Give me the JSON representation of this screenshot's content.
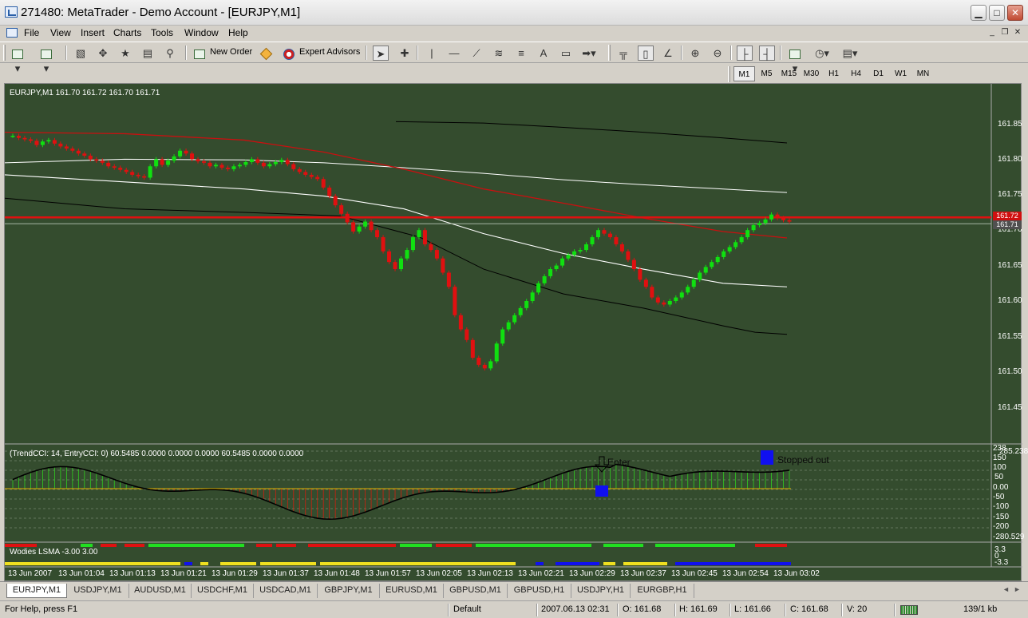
{
  "window": {
    "title": "271480: MetaTrader - Demo Account - [EURJPY,M1]",
    "min_glyph": "▁",
    "max_glyph": "□",
    "close_glyph": "✕"
  },
  "menu": {
    "items": [
      "File",
      "View",
      "Insert",
      "Charts",
      "Tools",
      "Window",
      "Help"
    ],
    "mdi_min": "_",
    "mdi_restore": "❐",
    "mdi_close": "✕"
  },
  "toolbar": {
    "new_order_label": "New Order",
    "expert_advisors_label": "Expert Advisors",
    "icons": [
      "new-chart-icon",
      "profiles-icon",
      "market-watch-icon",
      "navigator-icon",
      "favorites-icon",
      "terminal-icon",
      "strategy-tester-icon",
      "new-order-icon",
      "metaeditor-icon",
      "expert-advisors-icon",
      "cursor-icon",
      "crosshair-icon",
      "vertical-line-icon",
      "horizontal-line-icon",
      "trendline-icon",
      "channel-icon",
      "fibonacci-icon",
      "text-icon",
      "text-label-icon",
      "arrows-icon",
      "bar-chart-icon",
      "candle-chart-icon",
      "line-chart-icon",
      "zoom-in-icon",
      "zoom-out-icon",
      "auto-scroll-icon",
      "chart-shift-icon",
      "indicators-icon",
      "periods-icon",
      "templates-icon"
    ]
  },
  "timeframes": {
    "items": [
      "M1",
      "M5",
      "M15",
      "M30",
      "H1",
      "H4",
      "D1",
      "W1",
      "MN"
    ],
    "active": "M1"
  },
  "chart": {
    "symbol_info": "EURJPY,M1  161.70 161.72 161.70 161.71",
    "price_ticks": [
      "161.85",
      "161.80",
      "161.75",
      "161.70",
      "161.65",
      "161.60",
      "161.55",
      "161.50",
      "161.45"
    ],
    "current_price_label": "161.71",
    "ask_price_label": "161.72",
    "time_ticks": [
      "13 Jun 2007",
      "13 Jun 01:04",
      "13 Jun 01:13",
      "13 Jun 01:21",
      "13 Jun 01:29",
      "13 Jun 01:37",
      "13 Jun 01:48",
      "13 Jun 01:57",
      "13 Jun 02:05",
      "13 Jun 02:13",
      "13 Jun 02:21",
      "13 Jun 02:29",
      "13 Jun 02:37",
      "13 Jun 02:45",
      "13 Jun 02:54",
      "13 Jun 03:02"
    ],
    "colors": {
      "background": "#344c2e",
      "bull": "#10e010",
      "bear": "#e01010",
      "band_white": "#ffffff",
      "band_black": "#000000",
      "band_red": "#c81010",
      "price_line": "#e01010"
    }
  },
  "cci": {
    "label": "(TrendCCI: 14, EntryCCI: 0)  60.5485 0.0000 0.0000 0.0000 60.5485 0.0000 0.0000",
    "ticks": [
      "200",
      "150",
      "100",
      "50",
      "0.00",
      "-50",
      "-100",
      "-150",
      "-200",
      "-280.529"
    ],
    "top_value": "238",
    "top_value_extra": "285.238",
    "enter_label": "Enter",
    "stopped_label": "Stopped out"
  },
  "wodies": {
    "label": "Wodies LSMA -3.00 3.00",
    "ticks": [
      "3.3",
      "0",
      "-3.3"
    ]
  },
  "tabs": {
    "items": [
      "EURJPY,M1",
      "USDJPY,M1",
      "AUDUSD,M1",
      "USDCHF,M1",
      "USDCAD,M1",
      "GBPJPY,M1",
      "EURUSD,M1",
      "GBPUSD,M1",
      "GBPUSD,H1",
      "USDJPY,H1",
      "EURGBP,H1"
    ],
    "active": "EURJPY,M1",
    "nav_left": "◄",
    "nav_right": "►"
  },
  "status": {
    "help": "For Help, press F1",
    "profile": "Default",
    "datetime": "2007.06.13 02:31",
    "open": "O: 161.68",
    "high": "H: 161.69",
    "low": "L: 161.66",
    "close": "C: 161.68",
    "volume": "V: 20",
    "traffic": "139/1 kb"
  }
}
